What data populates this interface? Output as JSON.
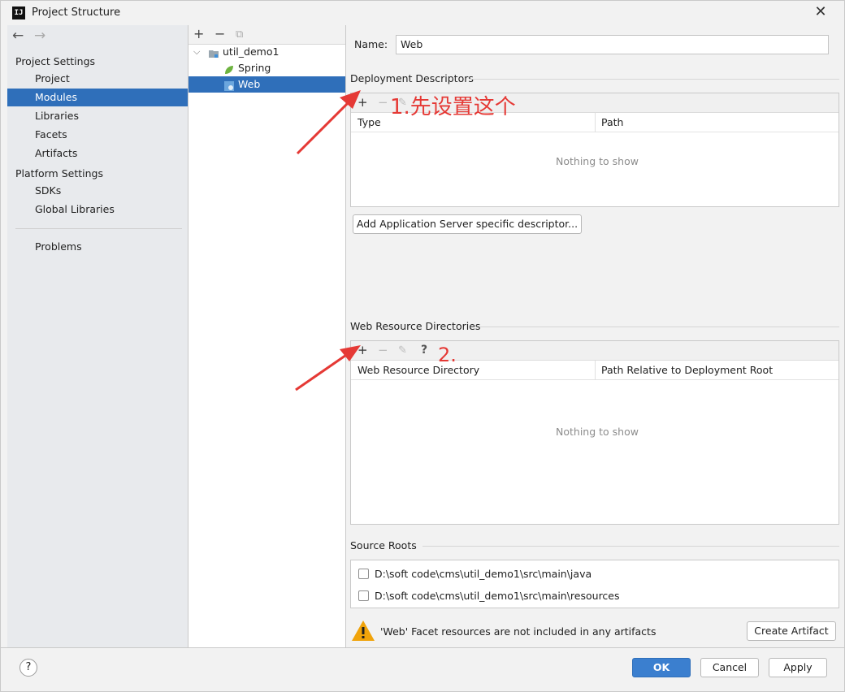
{
  "window": {
    "title": "Project Structure",
    "logo": "IJ"
  },
  "nav": {
    "back_icon": "←",
    "forward_icon": "→"
  },
  "sidebar": {
    "project_settings_header": "Project Settings",
    "project_settings": [
      "Project",
      "Modules",
      "Libraries",
      "Facets",
      "Artifacts"
    ],
    "platform_settings_header": "Platform Settings",
    "platform_settings": [
      "SDKs",
      "Global Libraries"
    ],
    "problems": "Problems",
    "selected": "Modules"
  },
  "tree": {
    "toolbar": {
      "add": "+",
      "remove": "−",
      "copy": "⧉"
    },
    "module": "util_demo1",
    "children": [
      "Spring",
      "Web"
    ],
    "selected": "Web"
  },
  "name_field": {
    "label": "Name:",
    "value": "Web"
  },
  "deployment": {
    "title": "Deployment Descriptors",
    "columns": [
      "Type",
      "Path"
    ],
    "empty_text": "Nothing to show",
    "add_server_button": "Add Application Server specific descriptor..."
  },
  "web_resources": {
    "title": "Web Resource Directories",
    "columns": [
      "Web Resource Directory",
      "Path Relative to Deployment Root"
    ],
    "empty_text": "Nothing to show",
    "help_icon": "?"
  },
  "source_roots": {
    "title": "Source Roots",
    "items": [
      "D:\\soft code\\cms\\util_demo1\\src\\main\\java",
      "D:\\soft code\\cms\\util_demo1\\src\\main\\resources"
    ]
  },
  "warning": {
    "text": "'Web' Facet resources are not included in any artifacts",
    "button": "Create Artifact"
  },
  "annotations": {
    "step1": "1.先设置这个",
    "step2": "2."
  },
  "footer": {
    "ok": "OK",
    "cancel": "Cancel",
    "apply": "Apply",
    "help": "?"
  },
  "colors": {
    "selection": "#2f6fba",
    "annotation": "#e53935",
    "warning": "#f0a30a"
  }
}
